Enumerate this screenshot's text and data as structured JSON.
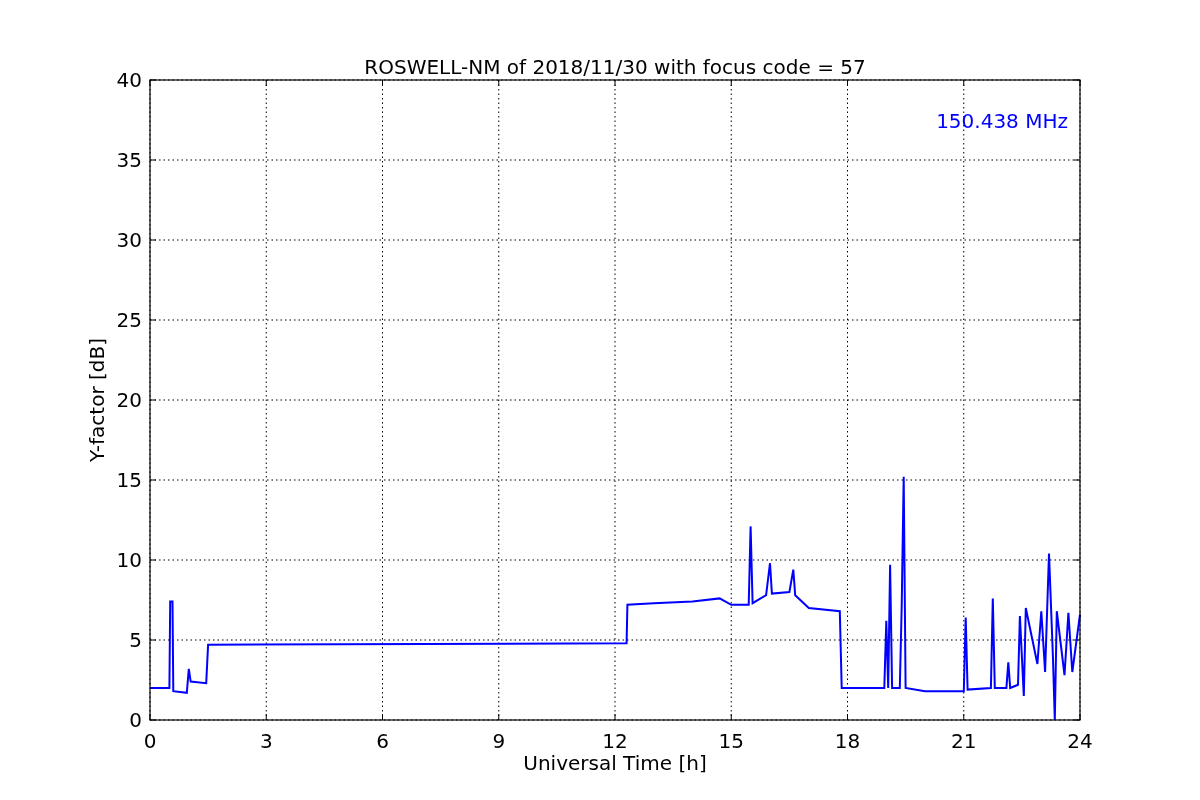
{
  "figure": {
    "chart_data": {
      "type": "line",
      "title": "ROSWELL-NM of 2018/11/30 with focus code = 57",
      "xlabel": "Universal Time [h]",
      "ylabel": "Y-factor [dB]",
      "x": [
        0,
        0.5,
        0.52,
        0.58,
        0.6,
        0.95,
        1.0,
        1.05,
        1.45,
        1.5,
        12.3,
        12.32,
        13,
        14,
        14.7,
        15,
        15.45,
        15.5,
        15.55,
        15.9,
        16,
        16.05,
        16.5,
        16.6,
        16.65,
        17,
        17.8,
        17.85,
        18.5,
        18.95,
        19.0,
        19.05,
        19.1,
        19.15,
        19.35,
        19.4,
        19.45,
        19.5,
        20,
        21,
        21.05,
        21.1,
        21.7,
        21.75,
        21.8,
        22.1,
        22.15,
        22.2,
        22.4,
        22.45,
        22.55,
        22.6,
        22.9,
        23,
        23.1,
        23.2,
        23.3,
        23.35,
        23.4,
        23.6,
        23.7,
        23.8,
        24
      ],
      "series": [
        {
          "name": "150.438 MHz",
          "color": "#0000ff",
          "values": [
            2.0,
            2.0,
            7.4,
            7.4,
            1.8,
            1.7,
            3.2,
            2.4,
            2.3,
            4.7,
            4.8,
            7.2,
            7.3,
            7.4,
            7.6,
            7.2,
            7.2,
            12.1,
            7.3,
            7.8,
            9.8,
            7.9,
            8.0,
            9.4,
            7.8,
            7.0,
            6.8,
            2.0,
            2.0,
            2.0,
            6.2,
            2.0,
            9.7,
            2.0,
            2.0,
            7.1,
            15.2,
            2.0,
            1.8,
            1.8,
            6.4,
            1.9,
            2.0,
            7.6,
            2.0,
            2.0,
            3.6,
            2.0,
            2.2,
            6.5,
            1.5,
            7.0,
            3.5,
            6.8,
            3.0,
            10.4,
            4.0,
            0,
            6.8,
            2.8,
            6.7,
            3.0,
            6.6
          ]
        }
      ],
      "xlim": [
        0,
        24
      ],
      "ylim": [
        0,
        40
      ],
      "xticks": [
        0,
        3,
        6,
        9,
        12,
        15,
        18,
        21,
        24
      ],
      "yticks": [
        0,
        5,
        10,
        15,
        20,
        25,
        30,
        35,
        40
      ],
      "grid": true
    }
  }
}
